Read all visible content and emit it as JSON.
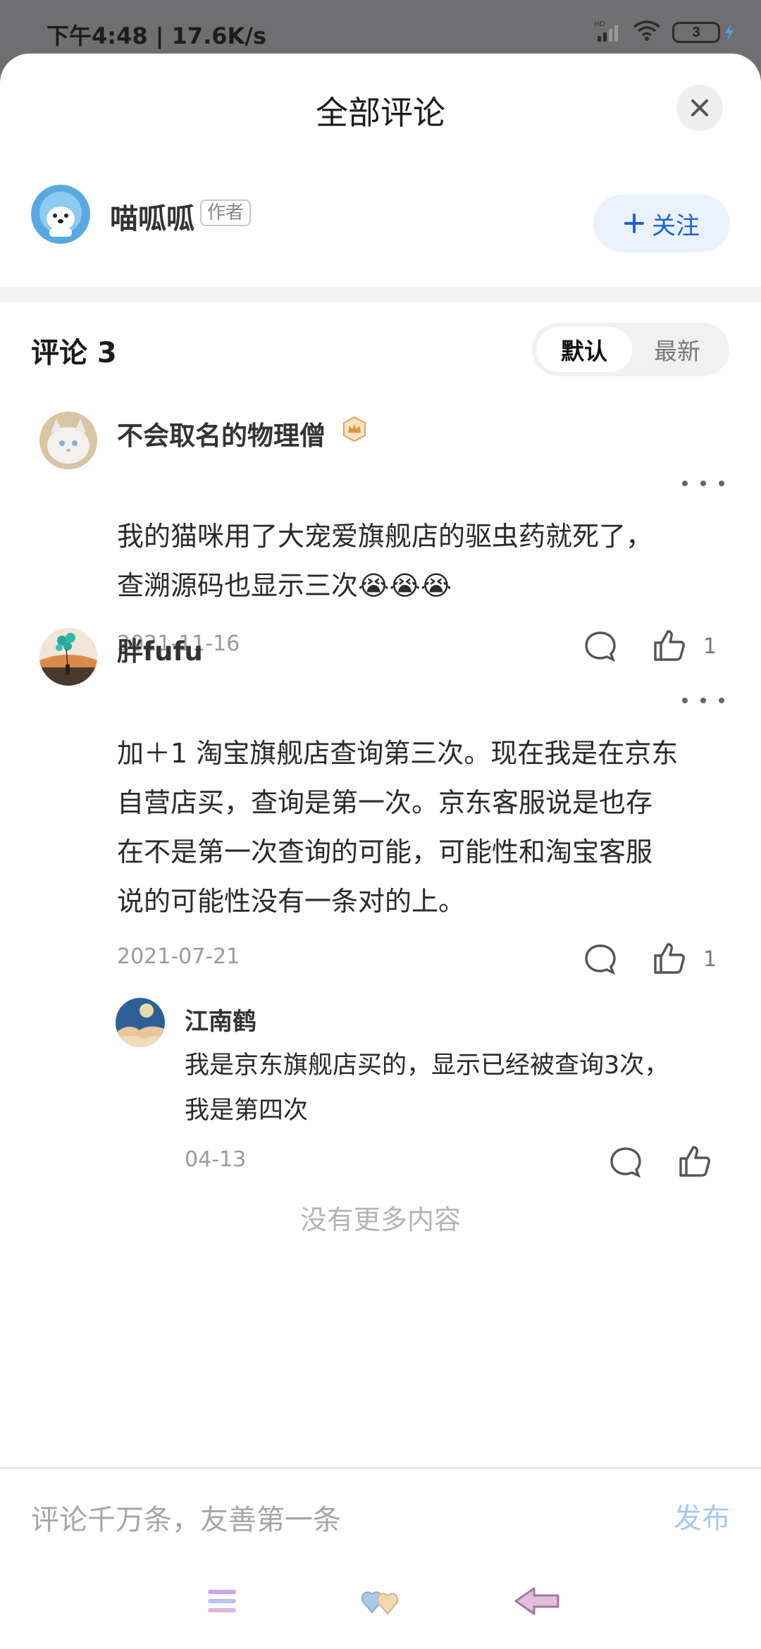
{
  "status_bar": {
    "time_speed": "下午4:48 | 17.6K/s",
    "battery": "3",
    "network": "HD"
  },
  "sheet": {
    "title": "全部评论"
  },
  "author": {
    "name": "喵呱呱",
    "tag": "作者",
    "follow_label": "关注"
  },
  "comments_header": {
    "label": "评论 3",
    "sort_default": "默认",
    "sort_latest": "最新"
  },
  "comments": [
    {
      "name": "不会取名的物理僧",
      "line1": "我的猫咪用了大宠爱旗舰店的驱虫药就死了，",
      "line2": "查溯源码也显示三次😭😭😭",
      "date": "2021-11-16",
      "likes": "1"
    },
    {
      "name": "胖fufu",
      "line1": "加＋1 淘宝旗舰店查询第三次。现在我是在京东",
      "line2": "自营店买，查询是第一次。京东客服说是也存",
      "line3": "在不是第一次查询的可能，可能性和淘宝客服",
      "line4": "说的可能性没有一条对的上。",
      "date": "2021-07-21",
      "likes": "1",
      "reply": {
        "name": "江南鹤",
        "line1": "我是京东旗舰店买的，显示已经被查询3次，",
        "line2": "我是第四次",
        "date": "04-13"
      }
    }
  ],
  "footer": {
    "no_more": "没有更多内容"
  },
  "input": {
    "placeholder": "评论千万条，友善第一条",
    "publish": "发布"
  },
  "colors": {
    "accent": "#1d63d6",
    "publish_disabled": "#a9c8f2",
    "follow_bg": "#eaf2fd"
  },
  "icons": [
    "close-icon",
    "plus-icon",
    "crown-badge-icon",
    "more-icon",
    "comment-icon",
    "like-icon",
    "menu-icon",
    "hearts-icon",
    "back-icon"
  ]
}
